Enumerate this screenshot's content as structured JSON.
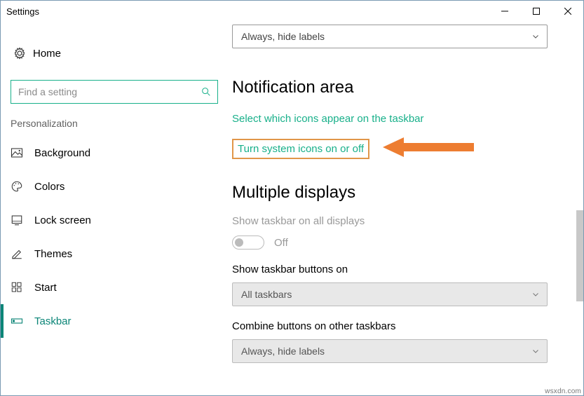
{
  "window": {
    "title": "Settings"
  },
  "sidebar": {
    "home": "Home",
    "search_placeholder": "Find a setting",
    "category": "Personalization",
    "items": [
      {
        "label": "Background"
      },
      {
        "label": "Colors"
      },
      {
        "label": "Lock screen"
      },
      {
        "label": "Themes"
      },
      {
        "label": "Start"
      },
      {
        "label": "Taskbar"
      }
    ]
  },
  "main": {
    "combine_dropdown_top": "Always, hide labels",
    "notification_heading": "Notification area",
    "link_select_icons": "Select which icons appear on the taskbar",
    "link_system_icons": "Turn system icons on or off",
    "multiple_heading": "Multiple displays",
    "show_all_label": "Show taskbar on all displays",
    "show_all_value": "Off",
    "show_buttons_label": "Show taskbar buttons on",
    "show_buttons_value": "All taskbars",
    "combine_other_label": "Combine buttons on other taskbars",
    "combine_other_value": "Always, hide labels"
  },
  "watermark": "wsxdn.com"
}
